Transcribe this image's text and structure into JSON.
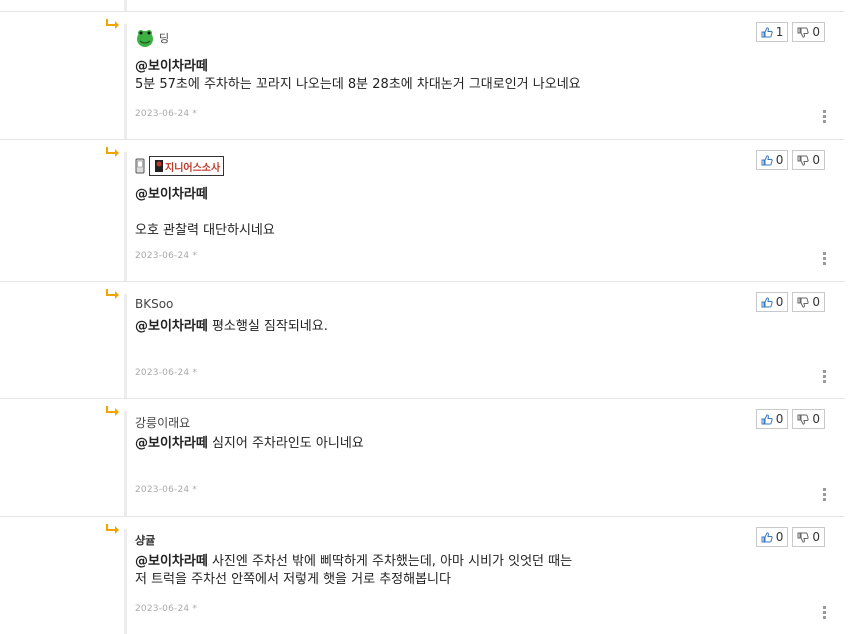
{
  "comments": [
    {
      "author": "딩",
      "mention": "@보이차라떼",
      "text": "5분 57초에 주차하는 꼬라지 나오는데 8분 28초에 차대논거 그대로인거 나오네요",
      "date": "2023-06-24 *",
      "likes": "1",
      "dislikes": "0"
    },
    {
      "author": "지니어스소사",
      "mention": "@보이차라떼",
      "text": "오호 관찰력 대단하시네요",
      "date": "2023-06-24 *",
      "likes": "0",
      "dislikes": "0"
    },
    {
      "author": "BKSoo",
      "mention": "@보이차라떼",
      "text": "평소행실 짐작되네요.",
      "date": "2023-06-24 *",
      "likes": "0",
      "dislikes": "0"
    },
    {
      "author": "강릉이래요",
      "mention": "@보이차라떼",
      "text": "심지어 주차라인도 아니네요",
      "date": "2023-06-24 *",
      "likes": "0",
      "dislikes": "0"
    },
    {
      "author": "샹귤",
      "mention": "@보이차라떼",
      "text": "사진엔 주차선 밖에 삐딱하게 주차했는데, 아마 시비가 잇엇던 때는",
      "text2": "저 트럭을 주차선 안쪽에서 저렇게 햇을 거로 추정해봅니다",
      "date": "2023-06-24 *",
      "likes": "0",
      "dislikes": "0"
    }
  ],
  "colors": {
    "arrow": "#f0a500",
    "border": "#e6e6e6",
    "date": "#aaaaaa"
  },
  "icons": {
    "reply": "reply-arrow-icon",
    "like": "thumbs-up-icon",
    "dislike": "thumbs-down-icon",
    "more": "more-vertical-icon"
  }
}
